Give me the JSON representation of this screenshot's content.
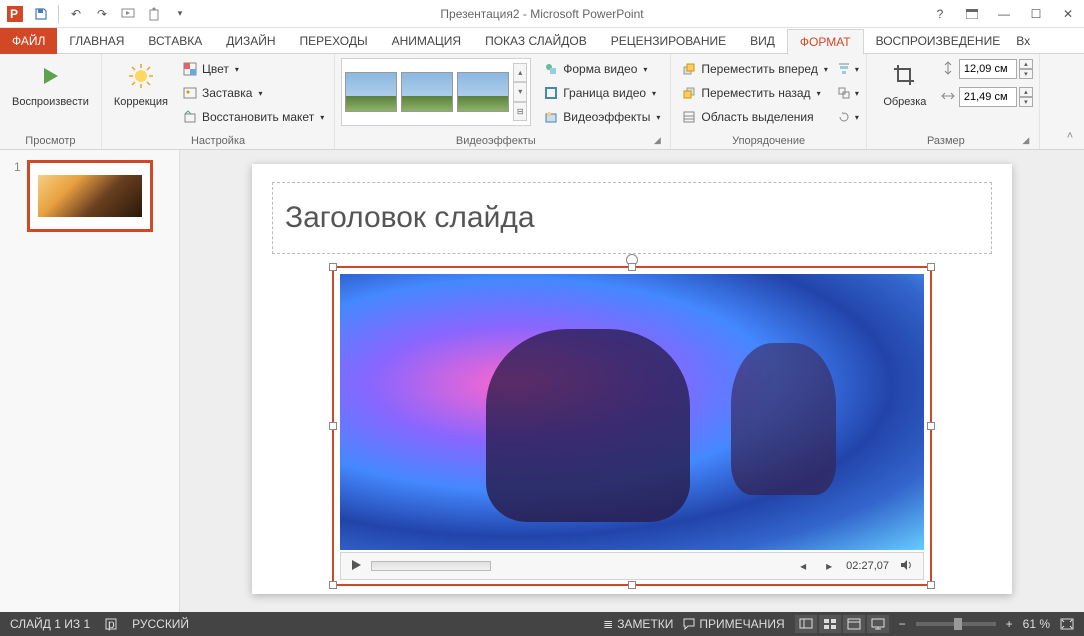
{
  "window": {
    "title": "Презентация2 - Microsoft PowerPoint"
  },
  "qat": {
    "icons": [
      "powerpoint",
      "save",
      "undo",
      "redo",
      "slideshow",
      "touch"
    ]
  },
  "tabs": [
    "ФАЙЛ",
    "ГЛАВНАЯ",
    "ВСТАВКА",
    "ДИЗАЙН",
    "ПЕРЕХОДЫ",
    "АНИМАЦИЯ",
    "ПОКАЗ СЛАЙДОВ",
    "РЕЦЕНЗИРОВАНИЕ",
    "ВИД",
    "ФОРМАТ",
    "ВОСПРОИЗВЕДЕНИЕ",
    "Вх"
  ],
  "active_tab": 9,
  "ribbon": {
    "preview": {
      "play": "Воспроизвести",
      "label": "Просмотр"
    },
    "adjust": {
      "corrections": "Коррекция",
      "color": "Цвет",
      "poster": "Заставка",
      "reset": "Восстановить макет",
      "label": "Настройка"
    },
    "effects": {
      "shape": "Форма видео",
      "border": "Граница видео",
      "fx": "Видеоэффекты",
      "label": "Видеоэффекты"
    },
    "arrange": {
      "forward": "Переместить вперед",
      "backward": "Переместить назад",
      "pane": "Область выделения",
      "label": "Упорядочение"
    },
    "size": {
      "crop": "Обрезка",
      "height": "12,09 см",
      "width": "21,49 см",
      "label": "Размер"
    }
  },
  "slide": {
    "number": "1",
    "title": "Заголовок слайда"
  },
  "player": {
    "time": "02:27,07"
  },
  "status": {
    "slide": "СЛАЙД 1 ИЗ 1",
    "lang": "РУССКИЙ",
    "notes": "ЗАМЕТКИ",
    "comments": "ПРИМЕЧАНИЯ",
    "zoom": "61 %"
  }
}
